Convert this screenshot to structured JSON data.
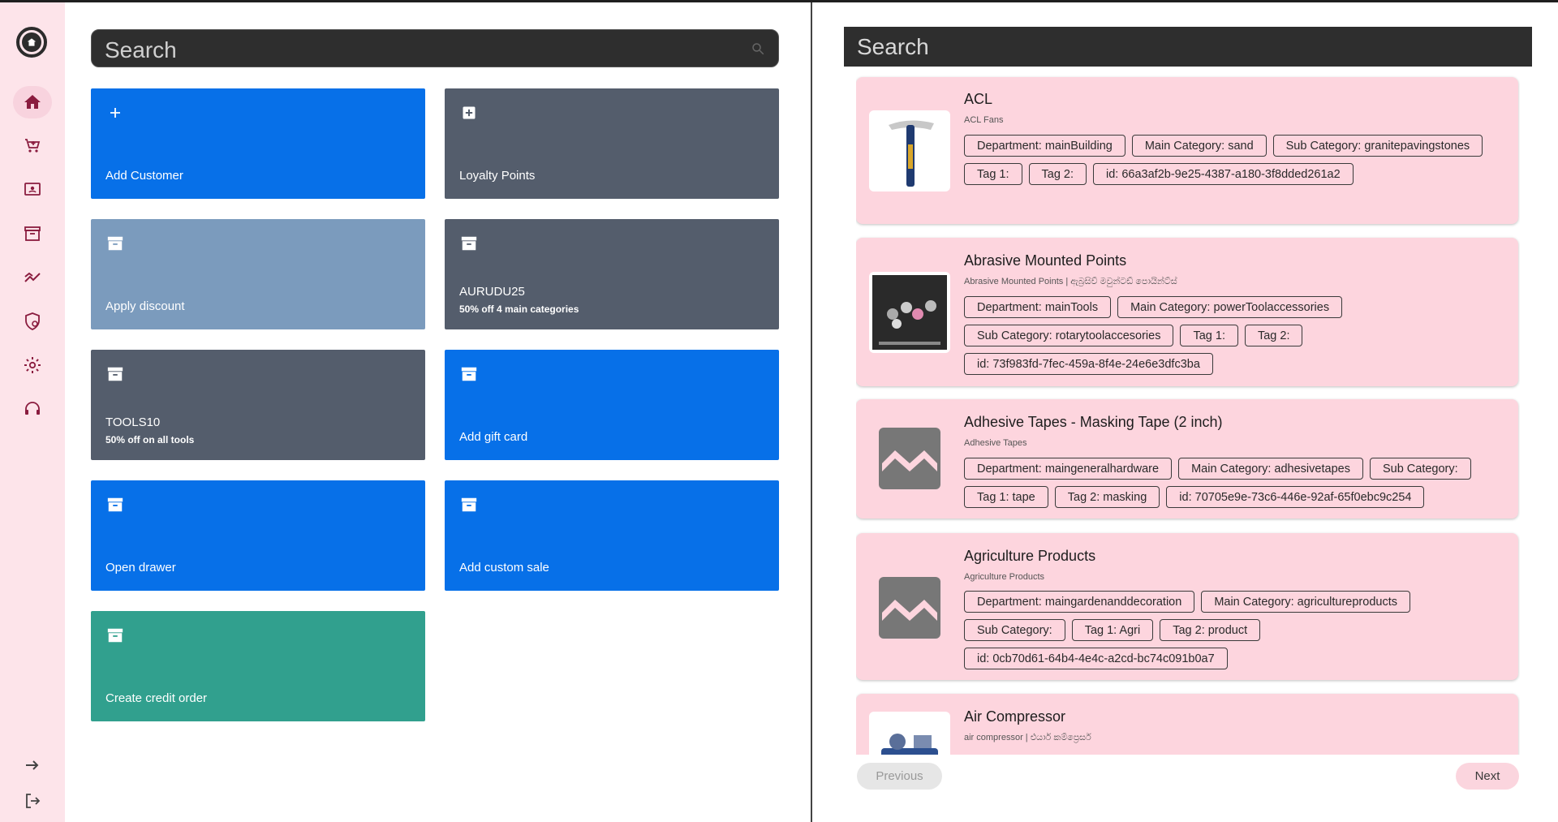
{
  "left_search": {
    "placeholder": "Search"
  },
  "right_search": {
    "placeholder": "Search"
  },
  "tiles": [
    {
      "label": "Add Customer",
      "sub": "",
      "icon": "plus-icon",
      "color": "#0770e8"
    },
    {
      "label": "Loyalty Points",
      "sub": "",
      "icon": "plus-box-icon",
      "color": "#545d6c"
    },
    {
      "label": "Apply discount",
      "sub": "",
      "icon": "archive-icon",
      "color": "#7b9bbd"
    },
    {
      "label": "AURUDU25",
      "sub": "50% off 4 main categories",
      "icon": "archive-icon",
      "color": "#545d6c"
    },
    {
      "label": "TOOLS10",
      "sub": "50% off on  all tools",
      "icon": "archive-icon",
      "color": "#545d6c"
    },
    {
      "label": "Add gift card",
      "sub": "",
      "icon": "archive-icon",
      "color": "#0770e8"
    },
    {
      "label": "Open drawer",
      "sub": "",
      "icon": "archive-icon",
      "color": "#0770e8"
    },
    {
      "label": "Add custom sale",
      "sub": "",
      "icon": "archive-icon",
      "color": "#0770e8"
    },
    {
      "label": "Create credit order",
      "sub": "",
      "icon": "archive-icon",
      "color": "#31a08e"
    }
  ],
  "products": [
    {
      "title": "ACL",
      "subtitle": "ACL Fans",
      "image": "hammer-image",
      "chips": [
        "Department: mainBuilding",
        "Main Category: sand",
        "Sub Category: granitepavingstones",
        "Tag 1:",
        "Tag 2:",
        "id: 66a3af2b-9e25-4387-a180-3f8dded261a2"
      ]
    },
    {
      "title": "Abrasive Mounted Points",
      "subtitle": "Abrasive Mounted Points | ඇබ්‍රසිව් මවුන්ටඩ් පොයින්ට්ස්",
      "image": "abrasive-points-image",
      "chips": [
        "Department: mainTools",
        "Main Category: powerToolaccessories",
        "Sub Category: rotarytoolaccesories",
        "Tag 1:",
        "Tag 2:",
        "id: 73f983fd-7fec-459a-8f4e-24e6e3dfc3ba"
      ]
    },
    {
      "title": "Adhesive Tapes - Masking Tape (2 inch)",
      "subtitle": "Adhesive Tapes",
      "image": "placeholder-image",
      "chips": [
        "Department: maingeneralhardware",
        "Main Category: adhesivetapes",
        "Sub Category:",
        "Tag 1: tape",
        "Tag 2: masking",
        "id: 70705e9e-73c6-446e-92af-65f0ebc9c254"
      ]
    },
    {
      "title": "Agriculture Products",
      "subtitle": "Agriculture Products",
      "image": "placeholder-image",
      "chips": [
        "Department: maingardenanddecoration",
        "Main Category: agricultureproducts",
        "Sub Category:",
        "Tag 1: Agri",
        "Tag 2: product",
        "id: 0cb70d61-64b4-4e4c-a2cd-bc74c091b0a7"
      ]
    },
    {
      "title": "Air Compressor",
      "subtitle": "air compressor | එයාර් කම්ප්‍රෙසර්",
      "image": "compressor-image",
      "chips": []
    }
  ],
  "pagination": {
    "previous": "Previous",
    "next": "Next"
  },
  "sidebar": {
    "items": [
      "home-icon",
      "cart-icon",
      "contact-icon",
      "archive-icon",
      "trending-icon",
      "policy-icon",
      "settings-icon",
      "support-icon"
    ],
    "bottom": [
      "arrow-right-icon",
      "logout-icon"
    ]
  }
}
